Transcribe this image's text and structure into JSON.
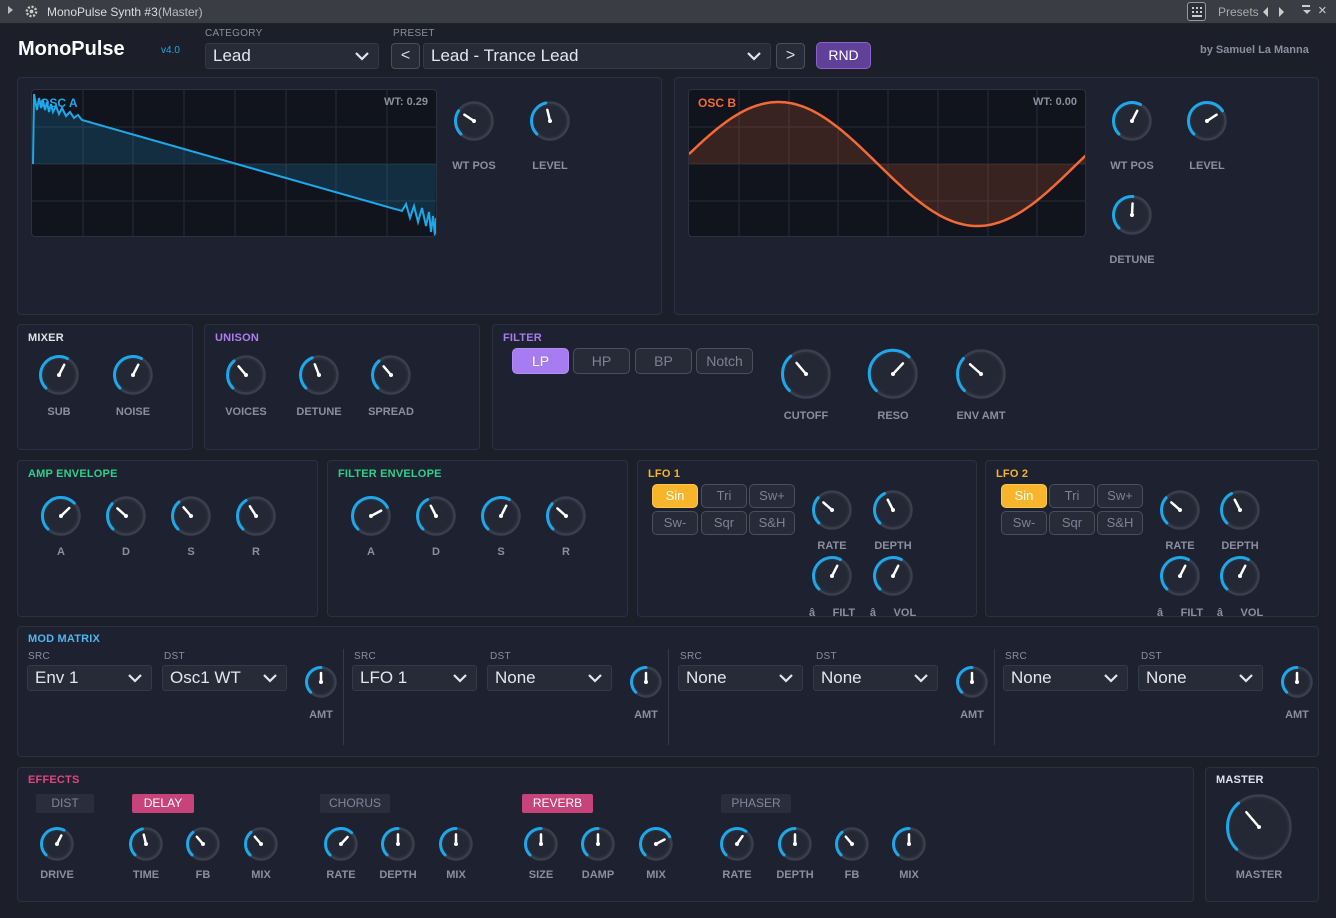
{
  "titlebar": {
    "title": "MonoPulse Synth #3",
    "subtitle": "(Master)",
    "presets_label": "Presets"
  },
  "header": {
    "app_name": "MonoPulse",
    "version": "v4.0",
    "credit": "by Samuel La Manna",
    "category_label": "CATEGORY",
    "category_value": "Lead",
    "preset_label": "PRESET",
    "preset_value": "Lead - Trance Lead",
    "prev_label": "<",
    "next_label": ">",
    "rnd_label": "RND"
  },
  "osc_a": {
    "title": "OSC A",
    "wt_readout": "WT: 0.29",
    "knobs": [
      {
        "label": "WT POS",
        "value": 0.29
      },
      {
        "label": "LEVEL",
        "value": 0.45
      }
    ]
  },
  "osc_b": {
    "title": "OSC B",
    "wt_readout": "WT: 0.00",
    "knobs": [
      {
        "label": "WT POS",
        "value": 0.6
      },
      {
        "label": "LEVEL",
        "value": 0.71
      },
      {
        "label": "DETUNE",
        "value": 0.51
      }
    ]
  },
  "mixer": {
    "title": "MIXER",
    "knobs": [
      {
        "label": "SUB",
        "value": 0.6
      },
      {
        "label": "NOISE",
        "value": 0.6
      }
    ]
  },
  "unison": {
    "title": "UNISON",
    "knobs": [
      {
        "label": "VOICES",
        "value": 0.35
      },
      {
        "label": "DETUNE",
        "value": 0.42
      },
      {
        "label": "SPREAD",
        "value": 0.35
      }
    ]
  },
  "filter": {
    "title": "FILTER",
    "types": [
      "LP",
      "HP",
      "BP",
      "Notch"
    ],
    "active_type": "LP",
    "knobs": [
      {
        "label": "CUTOFF",
        "value": 0.35
      },
      {
        "label": "RESO",
        "value": 0.66
      },
      {
        "label": "ENV AMT",
        "value": 0.32
      }
    ]
  },
  "amp_env": {
    "title": "AMP ENVELOPE",
    "knobs": [
      {
        "label": "A",
        "value": 0.67
      },
      {
        "label": "D",
        "value": 0.32
      },
      {
        "label": "S",
        "value": 0.35
      },
      {
        "label": "R",
        "value": 0.38
      }
    ]
  },
  "filter_env": {
    "title": "FILTER ENVELOPE",
    "knobs": [
      {
        "label": "A",
        "value": 0.73
      },
      {
        "label": "D",
        "value": 0.4
      },
      {
        "label": "S",
        "value": 0.6
      },
      {
        "label": "R",
        "value": 0.32
      }
    ]
  },
  "lfo1": {
    "title": "LFO 1",
    "shapes": [
      "Sin",
      "Tri",
      "Sw+",
      "Sw-",
      "Sqr",
      "S&H"
    ],
    "active_shape": "Sin",
    "knobs": [
      {
        "label": "RATE",
        "value": 0.32
      },
      {
        "label": "DEPTH",
        "value": 0.4
      },
      {
        "label": "âFILT",
        "value": 0.6
      },
      {
        "label": "âVOL",
        "value": 0.6
      }
    ]
  },
  "lfo2": {
    "title": "LFO 2",
    "shapes": [
      "Sin",
      "Tri",
      "Sw+",
      "Sw-",
      "Sqr",
      "S&H"
    ],
    "active_shape": "Sin",
    "knobs": [
      {
        "label": "RATE",
        "value": 0.32
      },
      {
        "label": "DEPTH",
        "value": 0.4
      },
      {
        "label": "âFILT",
        "value": 0.6
      },
      {
        "label": "âVOL",
        "value": 0.6
      }
    ]
  },
  "mod_matrix": {
    "title": "MOD MATRIX",
    "src_label": "SRC",
    "dst_label": "DST",
    "amt_label": "AMT",
    "slots": [
      {
        "src": "Env 1",
        "dst": "Osc1 WT",
        "amt": 0.5
      },
      {
        "src": "LFO 1",
        "dst": "None",
        "amt": 0.5
      },
      {
        "src": "None",
        "dst": "None",
        "amt": 0.5
      },
      {
        "src": "None",
        "dst": "None",
        "amt": 0.5
      }
    ]
  },
  "effects": {
    "title": "EFFECTS",
    "units": [
      {
        "name": "DIST",
        "on": false,
        "knobs": [
          {
            "label": "DRIVE",
            "value": 0.6
          }
        ]
      },
      {
        "name": "DELAY",
        "on": true,
        "knobs": [
          {
            "label": "TIME",
            "value": 0.45
          },
          {
            "label": "FB",
            "value": 0.35
          },
          {
            "label": "MIX",
            "value": 0.35
          }
        ]
      },
      {
        "name": "CHORUS",
        "on": false,
        "knobs": [
          {
            "label": "RATE",
            "value": 0.66
          },
          {
            "label": "DEPTH",
            "value": 0.5
          },
          {
            "label": "MIX",
            "value": 0.5
          }
        ]
      },
      {
        "name": "REVERB",
        "on": true,
        "knobs": [
          {
            "label": "SIZE",
            "value": 0.5
          },
          {
            "label": "DAMP",
            "value": 0.5
          },
          {
            "label": "MIX",
            "value": 0.73
          }
        ]
      },
      {
        "name": "PHASER",
        "on": false,
        "knobs": [
          {
            "label": "RATE",
            "value": 0.63
          },
          {
            "label": "DEPTH",
            "value": 0.5
          },
          {
            "label": "FB",
            "value": 0.35
          },
          {
            "label": "MIX",
            "value": 0.5
          }
        ]
      }
    ]
  },
  "master": {
    "title": "MASTER",
    "knob": {
      "label": "MASTER",
      "value": 0.35
    }
  },
  "colors": {
    "accent": "#1ea8ea",
    "osc_a": "#1ea8ea",
    "osc_b": "#f46a36",
    "unison": "#b07cf0",
    "filter": "#a77cf0",
    "env": "#2ecf8a",
    "lfo": "#f7b52b",
    "mod": "#4fb6f0",
    "effects": "#e2447f"
  }
}
